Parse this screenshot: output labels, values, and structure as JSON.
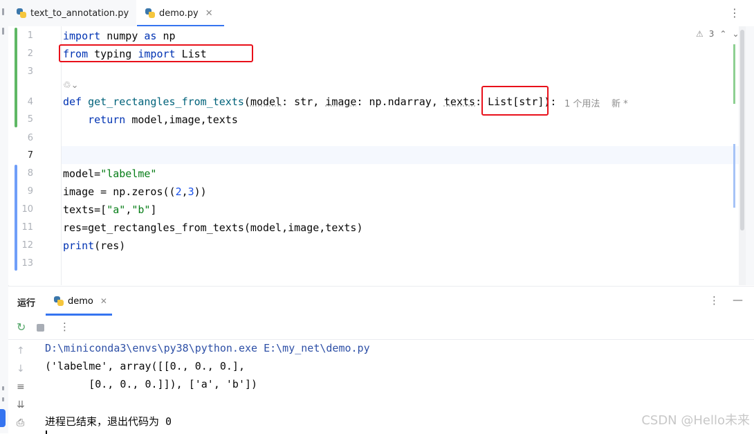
{
  "tabs": [
    {
      "label": "text_to_annotation.py",
      "active": false
    },
    {
      "label": "demo.py",
      "active": true
    }
  ],
  "editor": {
    "line_numbers": [
      "1",
      "2",
      "3",
      "4",
      "5",
      "6",
      "7",
      "8",
      "9",
      "10",
      "11",
      "12",
      "13"
    ],
    "current_line": "7",
    "inspection_count": "3",
    "hint_usage": "1 个用法",
    "hint_new": "新 *"
  },
  "run_panel": {
    "title": "运行",
    "tab_label": "demo",
    "output": [
      "D:\\miniconda3\\envs\\py38\\python.exe E:\\my_net\\demo.py",
      "('labelme', array([[0., 0., 0.],",
      "       [0., 0., 0.]]), ['a', 'b'])",
      "",
      "进程已结束，退出代码为 0"
    ]
  },
  "watermark": "CSDN @Hello未来",
  "colors": {
    "keyword": "#0033b3",
    "function": "#00627a",
    "string": "#067d17",
    "number": "#1750eb",
    "accent": "#3574f0",
    "highlight_box": "#e8101a"
  }
}
